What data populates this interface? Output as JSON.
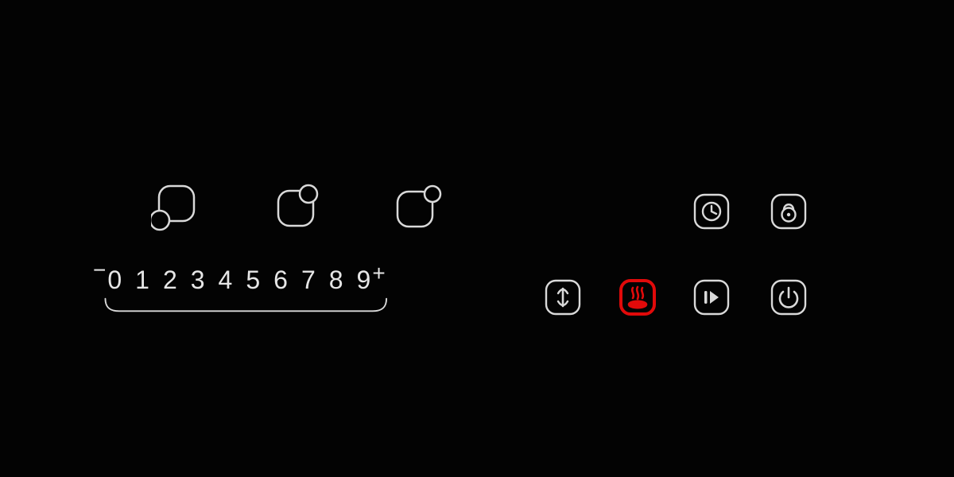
{
  "slider": {
    "minus_symbol": "−",
    "plus_symbol": "+",
    "levels": [
      "0",
      "1",
      "2",
      "3",
      "4",
      "5",
      "6",
      "7",
      "8",
      "9"
    ]
  },
  "zones": [
    {
      "name": "zone-front-left",
      "icon": "zone-front-left-icon"
    },
    {
      "name": "zone-rear-right-a",
      "icon": "zone-rear-right-a-icon"
    },
    {
      "name": "zone-rear-right-b",
      "icon": "zone-rear-right-b-icon"
    }
  ],
  "controls": {
    "timer": {
      "name": "timer-button",
      "icon": "clock-icon"
    },
    "lock": {
      "name": "lock-button",
      "icon": "lock-icon"
    },
    "boost": {
      "name": "boost-button",
      "icon": "boost-icon"
    },
    "warm": {
      "name": "keep-warm-button",
      "icon": "steam-icon",
      "highlighted": true
    },
    "next": {
      "name": "play-pause-button",
      "icon": "play-next-icon"
    },
    "power": {
      "name": "power-button",
      "icon": "power-icon"
    }
  },
  "colors": {
    "panel_bg": "#030303",
    "stroke": "#d9d9d9",
    "highlight": "#e10a0a"
  }
}
